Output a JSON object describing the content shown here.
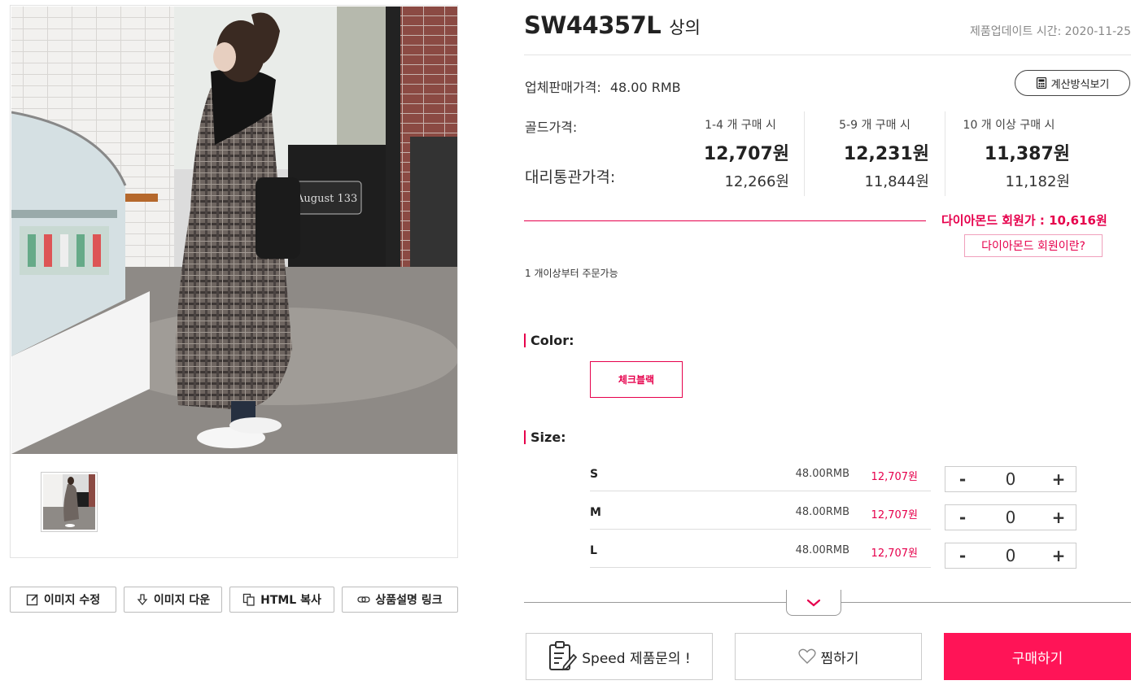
{
  "toolbar": {
    "edit_image": "이미지 수정",
    "download_image": "이미지 다운",
    "copy_html": "HTML 복사",
    "description_link": "상품설명 링크"
  },
  "product": {
    "sku": "SW44357L",
    "category": "상의",
    "updated": "제품업데이트 시간: 2020-11-25",
    "vendor_price_label": "업체판매가격:",
    "vendor_price": "48.00 RMB",
    "calc_button": "계산방식보기",
    "gold_label": "골드가격:",
    "agency_label": "대리통관가격:",
    "tiers": [
      {
        "qty": "1-4 개 구매 시",
        "gold": "12,707원",
        "agency": "12,266원"
      },
      {
        "qty": "5-9 개 구매 시",
        "gold": "12,231원",
        "agency": "11,844원"
      },
      {
        "qty": "10 개 이상 구매 시",
        "gold": "11,387원",
        "agency": "11,182원"
      }
    ],
    "diamond_price": "다이아몬드 회원가 : 10,616원",
    "diamond_link": "다이아몬드 회원이란?",
    "min_order": "1 개이상부터 주문가능"
  },
  "options": {
    "color_title": "Color:",
    "color_value": "체크블랙",
    "size_title": "Size:",
    "sizes": [
      {
        "name": "S",
        "rmb": "48.00RMB",
        "won": "12,707원",
        "qty": "0"
      },
      {
        "name": "M",
        "rmb": "48.00RMB",
        "won": "12,707원",
        "qty": "0"
      },
      {
        "name": "L",
        "rmb": "48.00RMB",
        "won": "12,707원",
        "qty": "0"
      }
    ],
    "minus": "-",
    "plus": "+"
  },
  "actions": {
    "inquiry": "Speed 제품문의 !",
    "wishlist": "찜하기",
    "buy": "구매하기"
  },
  "colors": {
    "accent": "#e6004c",
    "buy_button": "#ff1457"
  }
}
